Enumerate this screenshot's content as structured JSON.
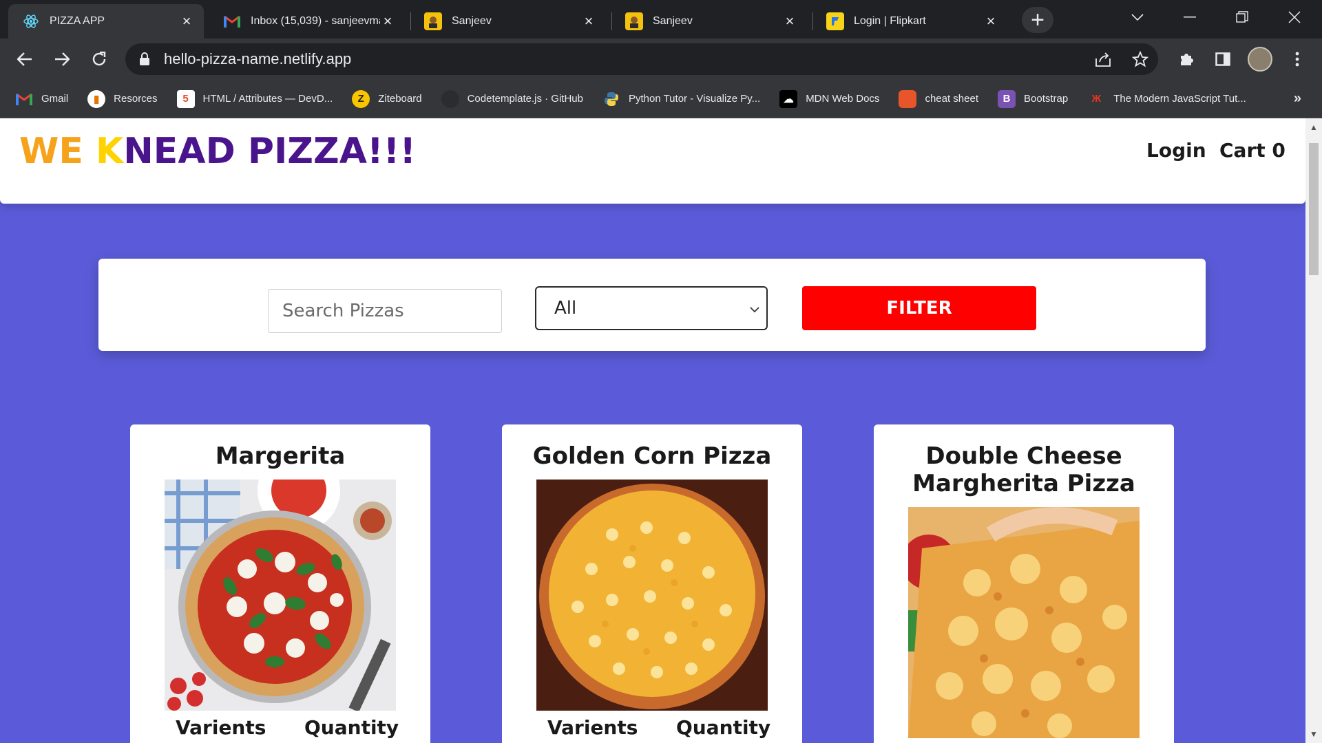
{
  "browser": {
    "tabs": [
      {
        "title": "PIZZA APP",
        "icon": "react-icon",
        "active": true
      },
      {
        "title": "Inbox (15,039) - sanjeevmar",
        "icon": "gmail-icon"
      },
      {
        "title": "Sanjeev",
        "icon": "avatar-icon"
      },
      {
        "title": "Sanjeev",
        "icon": "avatar-icon"
      },
      {
        "title": "Login | Flipkart",
        "icon": "flipkart-icon"
      }
    ],
    "url": "hello-pizza-name.netlify.app",
    "bookmarks": [
      {
        "label": "Gmail",
        "icon": "gmail-icon"
      },
      {
        "label": "Resorces",
        "icon": "resources-icon"
      },
      {
        "label": "HTML / Attributes — DevD...",
        "icon": "devdocs-icon"
      },
      {
        "label": "Ziteboard",
        "icon": "ziteboard-icon"
      },
      {
        "label": "Codetemplate.js · GitHub",
        "icon": "github-icon"
      },
      {
        "label": "Python Tutor - Visualize Py...",
        "icon": "python-icon"
      },
      {
        "label": "MDN Web Docs",
        "icon": "mdn-icon"
      },
      {
        "label": "cheat sheet",
        "icon": "cheatsheet-icon"
      },
      {
        "label": "Bootstrap",
        "icon": "bootstrap-icon"
      },
      {
        "label": "The Modern JavaScript Tut...",
        "icon": "javascript-info-icon"
      }
    ]
  },
  "header": {
    "brand_part1": "WE ",
    "brand_k": "K",
    "brand_part2": "NEAD PIZZA!!!",
    "login": "Login",
    "cart": "Cart 0"
  },
  "filter": {
    "search_placeholder": "Search Pizzas",
    "category_selected": "All",
    "button": "FILTER"
  },
  "pizzas": [
    {
      "name": "Margerita",
      "varients_label": "Varients",
      "quantity_label": "Quantity"
    },
    {
      "name": "Golden Corn Pizza",
      "varients_label": "Varients",
      "quantity_label": "Quantity"
    },
    {
      "name": "Double Cheese Margherita Pizza",
      "varients_label": "",
      "quantity_label": ""
    }
  ],
  "colors": {
    "page_bg": "#5b5bd9",
    "brand_orange": "#f7a21b",
    "brand_yellow": "#ffd200",
    "brand_purple": "#4a148c",
    "filter_red": "#ff0000"
  }
}
